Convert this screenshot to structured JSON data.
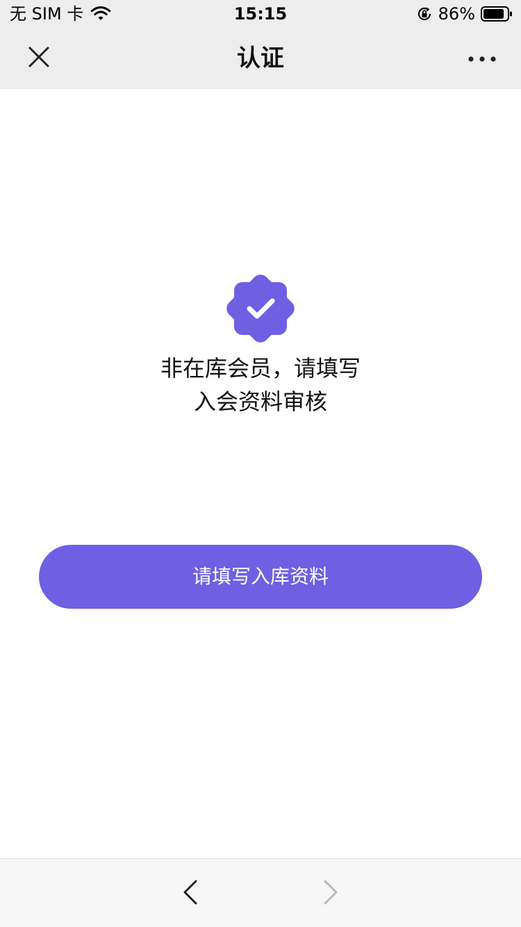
{
  "status_bar": {
    "carrier": "无 SIM 卡",
    "time": "15:15",
    "battery_percent": "86%",
    "icons": [
      "wifi-icon",
      "orientation-lock-icon",
      "battery-icon"
    ]
  },
  "nav": {
    "title": "认证",
    "icons": [
      "close-icon",
      "more-icon"
    ]
  },
  "content": {
    "badge_icon": "verified-badge-icon",
    "message_line1": "非在库会员，请填写",
    "message_line2": "入会资料审核",
    "button_label": "请填写入库资料"
  },
  "toolbar": {
    "icons": [
      "chevron-left-icon",
      "chevron-right-icon"
    ]
  },
  "colors": {
    "accent": "#6f5fe3",
    "nav_background": "#ededed",
    "toolbar_background": "#f7f7f7",
    "disabled": "#b8b8b8"
  }
}
